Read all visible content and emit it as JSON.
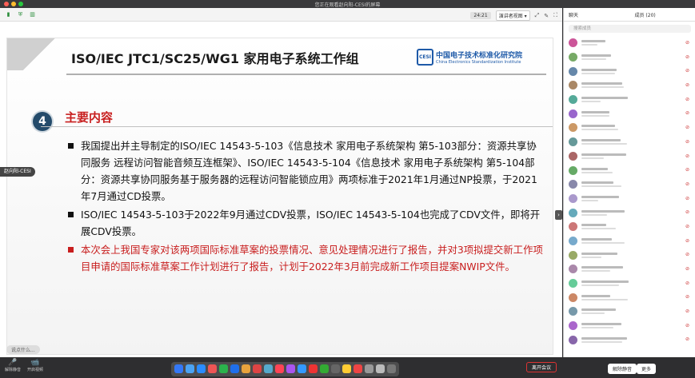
{
  "window": {
    "screen_title": "您正在观看赵向阳-CESI的屏幕"
  },
  "toolbar": {
    "clock": "24:21",
    "view_label": "演讲者视图"
  },
  "slide": {
    "title": "ISO/IEC JTC1/SC25/WG1 家用电子系统工作组",
    "logo": {
      "mark": "CESI",
      "cn": "中国电子技术标准化研究院",
      "en": "China Electronics Standardization Institute"
    },
    "section_number": "4",
    "section_title": "主要内容",
    "bullets": [
      "我国提出并主导制定的ISO/IEC 14543-5-103《信息技术 家用电子系统架构 第5-103部分：资源共享协同服务 远程访问智能音频互连框架》、ISO/IEC 14543-5-104《信息技术 家用电子系统架构 第5-104部分：资源共享协同服务基于服务器的远程访问智能锁应用》两项标准于2021年1月通过NP投票，于2021年7月通过CD投票。",
      "ISO/IEC 14543-5-103于2022年9月通过CDV投票，ISO/IEC 14543-5-104也完成了CDV文件，即将开展CDV投票。",
      "本次会上我国专家对该两项国际标准草案的投票情况、意见处理情况进行了报告，并对3项拟提交新工作项目申请的国际标准草案工作计划进行了报告，计划于2022年3月前完成新工作项目提案NWIP文件。"
    ]
  },
  "overlay": {
    "speaker_tag": "赵向阳-CESI",
    "chat_placeholder": "说点什么..."
  },
  "panel": {
    "tab_chat": "聊天",
    "tab_members": "成员 (20)",
    "search_placeholder": "搜索成员"
  },
  "bottom": {
    "mute": "解除静音",
    "video": "开启视频",
    "leave": "离开会议",
    "mute_all": "解除静音",
    "more": "更多"
  },
  "colors": {
    "accent_red": "#c82020",
    "brand_blue": "#1e5aa8",
    "circle_navy": "#244b6b"
  }
}
